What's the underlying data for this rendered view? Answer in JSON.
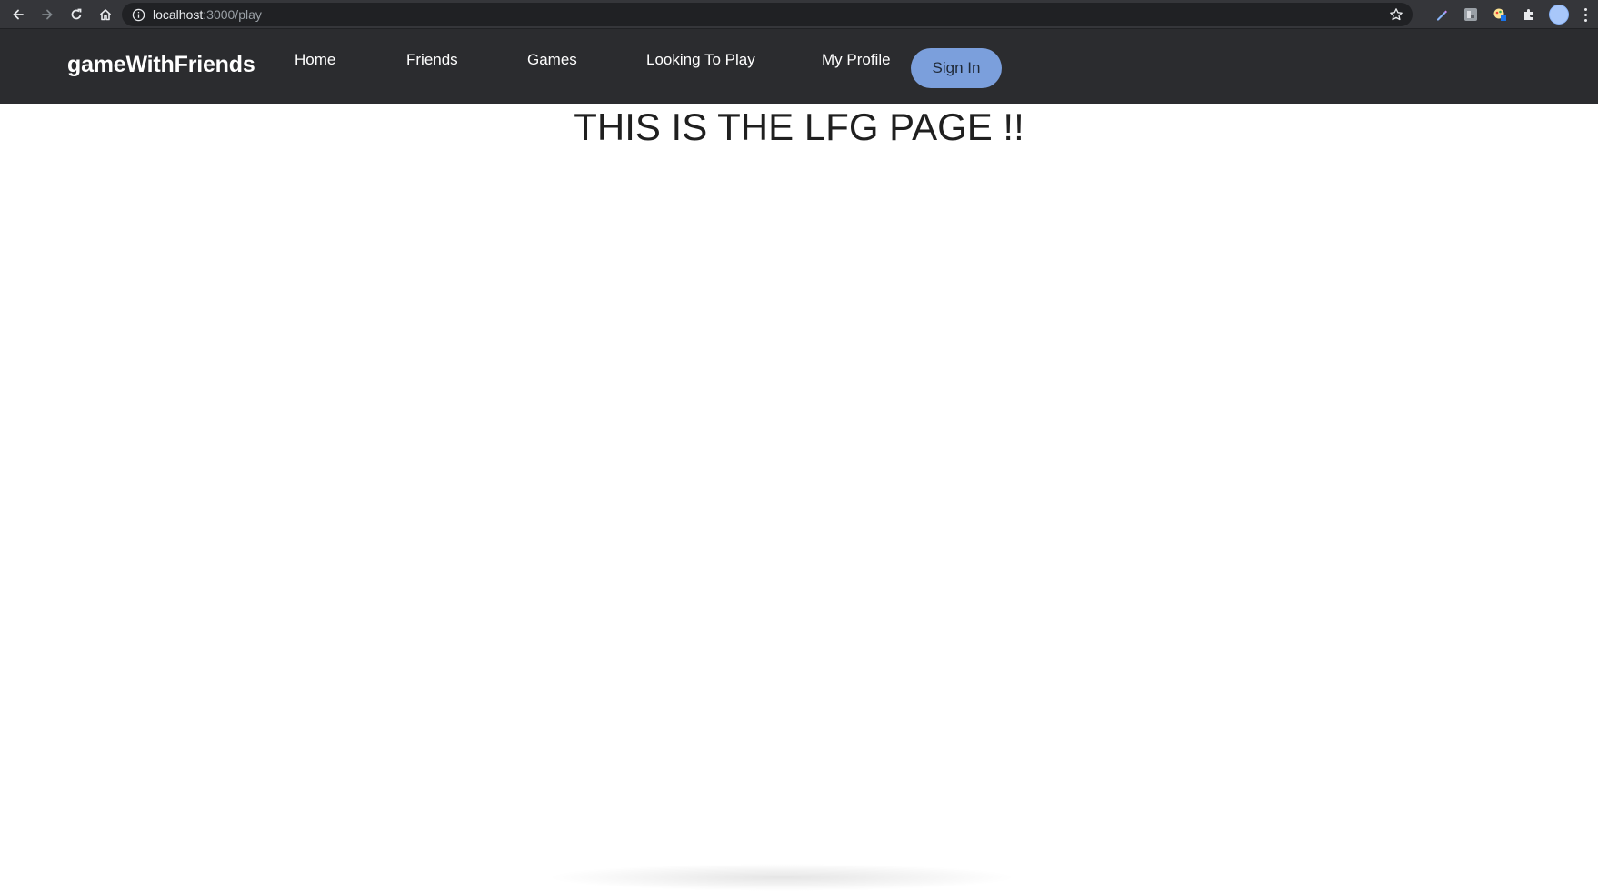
{
  "browser": {
    "url_host": "localhost",
    "url_path": ":3000/play"
  },
  "navbar": {
    "brand": "gameWithFriends",
    "links": [
      {
        "label": "Home"
      },
      {
        "label": "Friends"
      },
      {
        "label": "Games"
      },
      {
        "label": "Looking To Play"
      },
      {
        "label": "My Profile"
      }
    ],
    "signin_label": "Sign In",
    "colors": {
      "background": "#2b2c2f",
      "signin_bg": "#7b9fdc"
    }
  },
  "main": {
    "heading": "THIS IS THE LFG PAGE !!"
  },
  "icons": {
    "back": "back-arrow-icon",
    "forward": "forward-arrow-icon",
    "reload": "reload-icon",
    "home": "home-icon",
    "info": "info-icon",
    "bookmark": "star-icon",
    "extensions": [
      "pen-extension-icon",
      "translate-extension-icon",
      "palette-extension-icon",
      "puzzle-extensions-icon"
    ],
    "profile": "avatar",
    "menu": "kebab-menu-icon"
  }
}
